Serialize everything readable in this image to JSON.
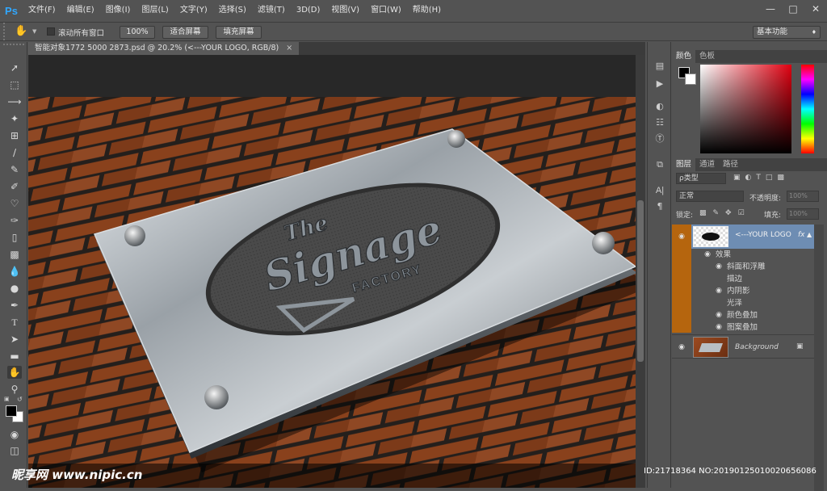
{
  "app": {
    "logo": "Ps"
  },
  "menu": [
    "文件(F)",
    "编辑(E)",
    "图像(I)",
    "图层(L)",
    "文字(Y)",
    "选择(S)",
    "滤镜(T)",
    "3D(D)",
    "视图(V)",
    "窗口(W)",
    "帮助(H)"
  ],
  "options": {
    "scroll_all": "滚动所有窗口",
    "zoom_100": "100%",
    "fit_screen": "适合屏幕",
    "fill_screen": "填充屏幕",
    "workspace": "基本功能"
  },
  "document": {
    "tab_title": "智能对象1772 5000 2873.psd @ 20.2% (<---YOUR LOGO, RGB/8)",
    "plate_title_1": "The",
    "plate_title_2": "Signage",
    "plate_title_3": "FACTORY"
  },
  "color_panel": {
    "tabs": [
      "颜色",
      "色板"
    ]
  },
  "layers_panel": {
    "tabs": [
      "图层",
      "通道",
      "路径"
    ],
    "filter_label": "ρ类型",
    "blend_mode": "正常",
    "opacity_label": "不透明度:",
    "opacity_value": "100%",
    "lock_label": "锁定:",
    "fill_label": "填充:",
    "fill_value": "100%",
    "logo_layer": "<---YOUR LOGO",
    "effects_label": "效果",
    "effects": [
      "斜面和浮雕",
      "描边",
      "内阴影",
      "光泽",
      "颜色叠加",
      "图案叠加"
    ],
    "background_layer": "Background"
  },
  "watermark": {
    "site": "昵享网 www.nipic.cn",
    "id": "ID:21718364 NO:20190125010020656086"
  }
}
